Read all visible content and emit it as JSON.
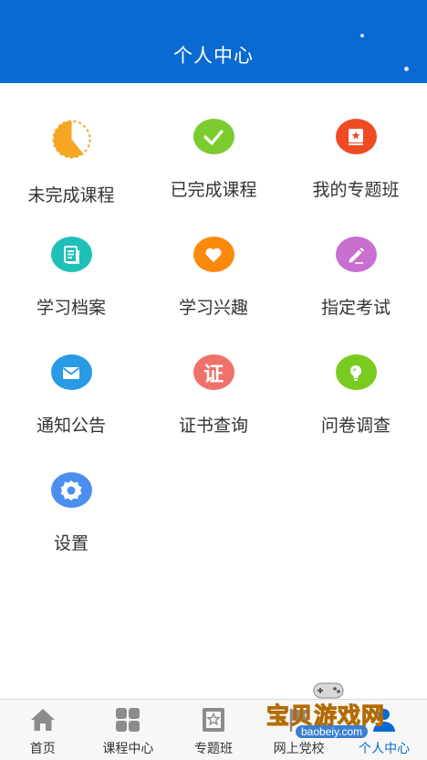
{
  "header": {
    "title": "个人中心"
  },
  "menu": [
    {
      "label": "未完成课程",
      "icon": "half-clock-icon",
      "color": "#f5a623"
    },
    {
      "label": "已完成课程",
      "icon": "check-icon",
      "color": "#7ccb2f"
    },
    {
      "label": "我的专题班",
      "icon": "book-star-icon",
      "color": "#f04a23"
    },
    {
      "label": "学习档案",
      "icon": "document-icon",
      "color": "#1ec0b8"
    },
    {
      "label": "学习兴趣",
      "icon": "heart-icon",
      "color": "#fb8a0c"
    },
    {
      "label": "指定考试",
      "icon": "pencil-icon",
      "color": "#c86fd0"
    },
    {
      "label": "通知公告",
      "icon": "mail-icon",
      "color": "#2b9ae6"
    },
    {
      "label": "证书查询",
      "icon": "certificate-icon",
      "color": "#f0716a",
      "glyph": "证"
    },
    {
      "label": "问卷调查",
      "icon": "lightbulb-icon",
      "color": "#79cc1f"
    },
    {
      "label": "设置",
      "icon": "gear-icon",
      "color": "#4b8ef0"
    }
  ],
  "tabbar": {
    "items": [
      {
        "label": "首页",
        "icon": "home-icon"
      },
      {
        "label": "课程中心",
        "icon": "grid-icon"
      },
      {
        "label": "专题班",
        "icon": "book-star-icon"
      },
      {
        "label": "网上党校",
        "icon": "flag-icon"
      },
      {
        "label": "个人中心",
        "icon": "person-icon"
      }
    ],
    "active_color": "#0a6ad2",
    "inactive_color": "#8c8c8c"
  },
  "watermark": {
    "text": "宝贝游戏网",
    "url": "baobeiy.com"
  }
}
